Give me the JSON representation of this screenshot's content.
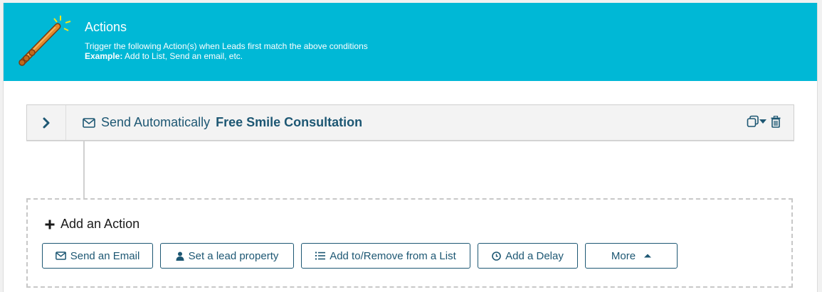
{
  "header": {
    "title": "Actions",
    "subtitle": "Trigger the following Action(s) when Leads first match the above conditions",
    "example_label": "Example:",
    "example_text": " Add to List, Send an email, etc.",
    "icon": "magic-wand-icon",
    "bg_color": "#00b8d6"
  },
  "action": {
    "prefix": "Send Automatically",
    "name": "Free Smile Consultation",
    "icons": [
      "chevron-right-icon",
      "envelope-icon",
      "copy-icon",
      "caret-down-icon",
      "trash-icon"
    ]
  },
  "add": {
    "title": "Add an Action",
    "buttons": [
      {
        "label": "Send an Email",
        "icon": "envelope-icon"
      },
      {
        "label": "Set a lead property",
        "icon": "user-icon"
      },
      {
        "label": "Add to/Remove from a List",
        "icon": "list-icon"
      },
      {
        "label": "Add a Delay",
        "icon": "clock-icon"
      },
      {
        "label": "More",
        "icon": "caret-up-icon"
      }
    ]
  },
  "colors": {
    "accent": "#1d5773",
    "header": "#00b8d6"
  }
}
